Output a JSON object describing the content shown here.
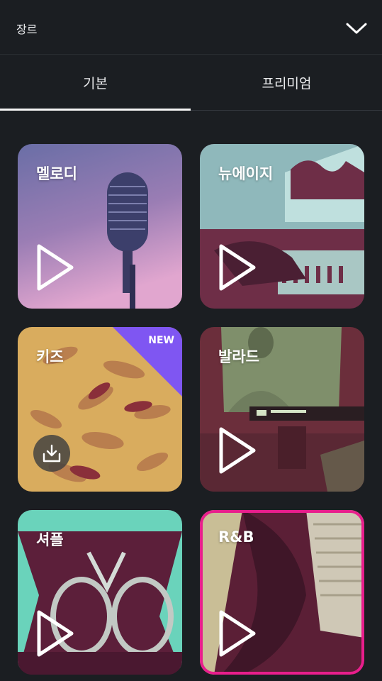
{
  "header": {
    "title": "장르"
  },
  "tabs": [
    {
      "label": "기본",
      "active": true
    },
    {
      "label": "프리미엄",
      "active": false
    }
  ],
  "genres": [
    {
      "label": "멜로디",
      "state": "play"
    },
    {
      "label": "뉴에이지",
      "state": "play"
    },
    {
      "label": "키즈",
      "state": "download",
      "badge": "NEW"
    },
    {
      "label": "발라드",
      "state": "play"
    },
    {
      "label": "셔플",
      "state": "play"
    },
    {
      "label": "R&B",
      "state": "play",
      "selected": true
    }
  ],
  "colors": {
    "background": "#1b1e22",
    "selected_border": "#e81e8c",
    "badge": "#7f56f2"
  }
}
